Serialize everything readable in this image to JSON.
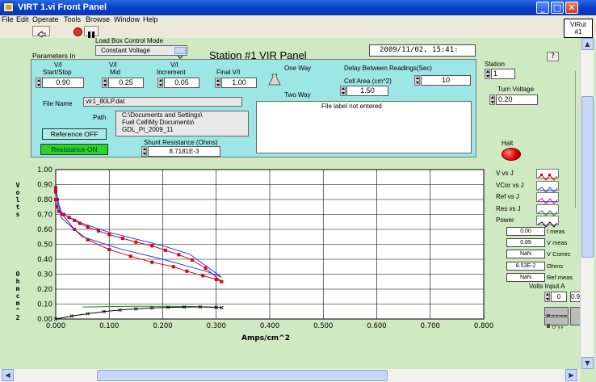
{
  "window": {
    "title": "VIRT 1.vi Front Panel",
    "min": "_",
    "max": "□",
    "close": "✕"
  },
  "menu": [
    "File",
    "Edit",
    "Operate",
    "Tools",
    "Browse",
    "Window",
    "Help"
  ],
  "vi_icon": {
    "line1": "VIRut",
    "line2": "#1"
  },
  "header": {
    "params_in": "Parameters In",
    "load_box_label": "Load Box Control Mode",
    "load_box_value": "Constant Voltage",
    "station_title": "Station #1 VIR Panel",
    "datetime": "2009/11/02,  15:41:"
  },
  "controls": {
    "start_stop": {
      "label1": "V/I",
      "label2": "Start/Stop",
      "value": "0.90"
    },
    "mid": {
      "label1": "V/I",
      "label2": "Mid",
      "value": "0.25"
    },
    "increment": {
      "label1": "V/I",
      "label2": "Increment",
      "value": "0.05"
    },
    "final": {
      "label": "Final V/I",
      "value": "1.00"
    },
    "one_way": "One Way",
    "two_way": "Two Way",
    "delay_label": "Delay Between Readings(Sec)",
    "delay_value": "10",
    "cell_area_label": "Cell Area (cm^2)",
    "cell_area_value": "1.50",
    "file_name_label": "File Name",
    "file_name_value": "vir1_80LP.dat",
    "path_label": "Path",
    "path_line1": "C:\\Documents and Settings\\",
    "path_line2": "Fuel Cell\\My Documents\\",
    "path_line3": "GDL_Pt_2009_11",
    "file_label_text": "File label not entered",
    "reference_btn": "Reference OFF",
    "resistance_btn": "Resistance ON",
    "shunt_label": "Shunt Resistance (Ohms)",
    "shunt_value": "8.7181E-3"
  },
  "side": {
    "station_label": "Station",
    "station_value": "1",
    "turn_voltage_label": "Turn Voltage",
    "turn_voltage_value": "0.20",
    "halt_label": "Halt"
  },
  "legend": [
    "V vs J",
    "VCor vs J",
    "Ref vs J",
    "Res vs J",
    "Power"
  ],
  "readouts": [
    {
      "value": "0.00",
      "label": "I meas"
    },
    {
      "value": "0.89",
      "label": "V meas"
    },
    {
      "value": "NaN",
      "label": "V Correc"
    },
    {
      "value": "8.53E-2",
      "label": "Ohms"
    },
    {
      "value": "NaN",
      "label": "Ref meas"
    }
  ],
  "volts_input": {
    "label": "Volts Input A",
    "index": "0",
    "value": "0.90"
  },
  "colors": {
    "panel": "#9de6e6",
    "background": "#cfe9c2",
    "v_vs_j": "#e00000",
    "vcor_vs_j": "#2040ff",
    "ref_vs_j": "#c000c0",
    "res_vs_j": "#208020",
    "power": "#000000"
  },
  "chart_data": {
    "type": "line",
    "xlabel": "Amps/cm^2",
    "ylabel_top": "Volts",
    "ylabel_bottom": "Ohm cm^2",
    "xlim": [
      0,
      0.8
    ],
    "ylim": [
      0,
      1.0
    ],
    "xticks": [
      "0.000",
      "0.100",
      "0.200",
      "0.300",
      "0.400",
      "0.500",
      "0.600",
      "0.700",
      "0.800"
    ],
    "yticks": [
      "0.00",
      "0.10",
      "0.20",
      "0.30",
      "0.40",
      "0.50",
      "0.60",
      "0.70",
      "0.80",
      "0.90",
      "1.00"
    ],
    "grid": true,
    "series": [
      {
        "name": "V vs J",
        "color": "#e00000",
        "marker": "square",
        "x": [
          0,
          0,
          0,
          0.002,
          0.006,
          0.015,
          0.025,
          0.035,
          0.045,
          0.06,
          0.08,
          0.1,
          0.125,
          0.15,
          0.18,
          0.205,
          0.23,
          0.255,
          0.28,
          0.31,
          0.3,
          0.275,
          0.245,
          0.22,
          0.18,
          0.14,
          0.1,
          0.06,
          0.035,
          0.012,
          0.003,
          0
        ],
        "y": [
          0.88,
          0.85,
          0.8,
          0.75,
          0.72,
          0.7,
          0.68,
          0.66,
          0.64,
          0.615,
          0.59,
          0.565,
          0.54,
          0.515,
          0.49,
          0.46,
          0.43,
          0.395,
          0.34,
          0.25,
          0.265,
          0.29,
          0.32,
          0.35,
          0.38,
          0.42,
          0.465,
          0.53,
          0.6,
          0.7,
          0.8,
          0.87
        ]
      },
      {
        "name": "VCor vs J",
        "color": "#2040ff",
        "marker": "none",
        "x": [
          0,
          0.005,
          0.02,
          0.05,
          0.1,
          0.15,
          0.2,
          0.25,
          0.31,
          0.28,
          0.2,
          0.12,
          0.05,
          0.01,
          0
        ],
        "y": [
          0.89,
          0.73,
          0.69,
          0.64,
          0.58,
          0.535,
          0.49,
          0.435,
          0.28,
          0.32,
          0.4,
          0.47,
          0.55,
          0.68,
          0.88
        ]
      },
      {
        "name": "Res vs J",
        "color": "#208020",
        "marker": "none",
        "x": [
          0.05,
          0.1,
          0.15,
          0.2,
          0.25,
          0.3
        ],
        "y": [
          0.08,
          0.083,
          0.085,
          0.085,
          0.083,
          0.08
        ]
      },
      {
        "name": "Power",
        "color": "#000000",
        "marker": "x",
        "x": [
          0,
          0.03,
          0.06,
          0.09,
          0.12,
          0.15,
          0.18,
          0.21,
          0.24,
          0.27,
          0.3,
          0.31
        ],
        "y": [
          0,
          0.02,
          0.035,
          0.05,
          0.06,
          0.068,
          0.074,
          0.078,
          0.08,
          0.081,
          0.078,
          0.076
        ]
      }
    ]
  }
}
